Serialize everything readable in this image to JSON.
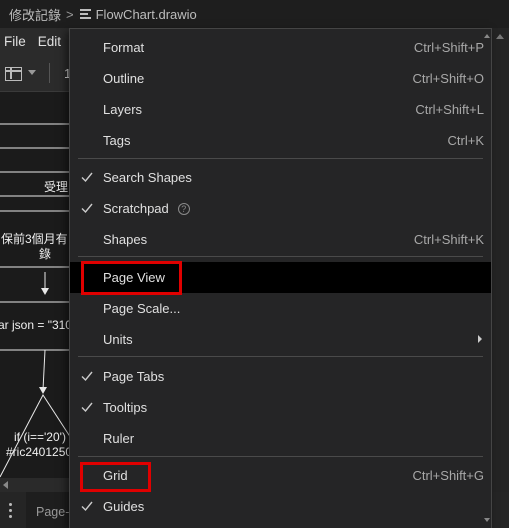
{
  "breadcrumb": {
    "folder": "修改記錄",
    "separator": ">",
    "file": "FlowChart.drawio"
  },
  "menubar": {
    "file_label": "File",
    "edit_label": "Edit"
  },
  "toolbar": {
    "zoom_text": "1"
  },
  "canvas": {
    "texts": [
      "受理",
      "保前3個月有",
      "錄",
      "ar json = \"310",
      "if (i=='20')",
      "#ric2401250"
    ]
  },
  "bottom": {
    "page_tab_label": "Page-"
  },
  "menu": {
    "items": [
      {
        "label": "Format",
        "shortcut": "Ctrl+Shift+P",
        "checked": false
      },
      {
        "label": "Outline",
        "shortcut": "Ctrl+Shift+O",
        "checked": false
      },
      {
        "label": "Layers",
        "shortcut": "Ctrl+Shift+L",
        "checked": false
      },
      {
        "label": "Tags",
        "shortcut": "Ctrl+K",
        "checked": false
      },
      {
        "label": "Search Shapes",
        "shortcut": "",
        "checked": true
      },
      {
        "label": "Scratchpad",
        "shortcut": "",
        "checked": true,
        "help": "?"
      },
      {
        "label": "Shapes",
        "shortcut": "Ctrl+Shift+K",
        "checked": false
      },
      {
        "label": "Page View",
        "shortcut": "",
        "checked": false,
        "highlighted": true,
        "boxed": true
      },
      {
        "label": "Page Scale...",
        "shortcut": "",
        "checked": false
      },
      {
        "label": "Units",
        "shortcut": "",
        "checked": false,
        "submenu": true
      },
      {
        "label": "Page Tabs",
        "shortcut": "",
        "checked": true
      },
      {
        "label": "Tooltips",
        "shortcut": "",
        "checked": true
      },
      {
        "label": "Ruler",
        "shortcut": "",
        "checked": false
      },
      {
        "label": "Grid",
        "shortcut": "Ctrl+Shift+G",
        "checked": false,
        "boxed": true
      },
      {
        "label": "Guides",
        "shortcut": "",
        "checked": true
      }
    ]
  },
  "colors": {
    "annotation_box": "#e00000",
    "menu_bg": "#252526",
    "highlight_bg": "#000000"
  }
}
